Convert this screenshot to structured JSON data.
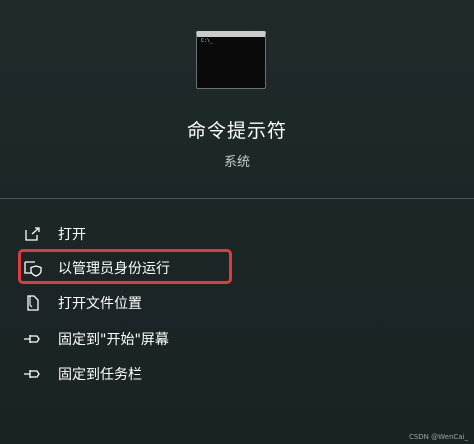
{
  "app": {
    "name": "命令提示符",
    "type": "系统",
    "icon": "cmd-window-icon",
    "prompt_text": "C:\\_"
  },
  "menu": {
    "items": [
      {
        "label": "打开",
        "icon": "open-external-icon"
      },
      {
        "label": "以管理员身份运行",
        "icon": "shield-admin-icon"
      },
      {
        "label": "打开文件位置",
        "icon": "file-location-icon"
      },
      {
        "label": "固定到\"开始\"屏幕",
        "icon": "pin-icon"
      },
      {
        "label": "固定到任务栏",
        "icon": "pin-icon"
      }
    ]
  },
  "highlight_color": "#e03a3a",
  "watermark": "CSDN @WenCai_"
}
